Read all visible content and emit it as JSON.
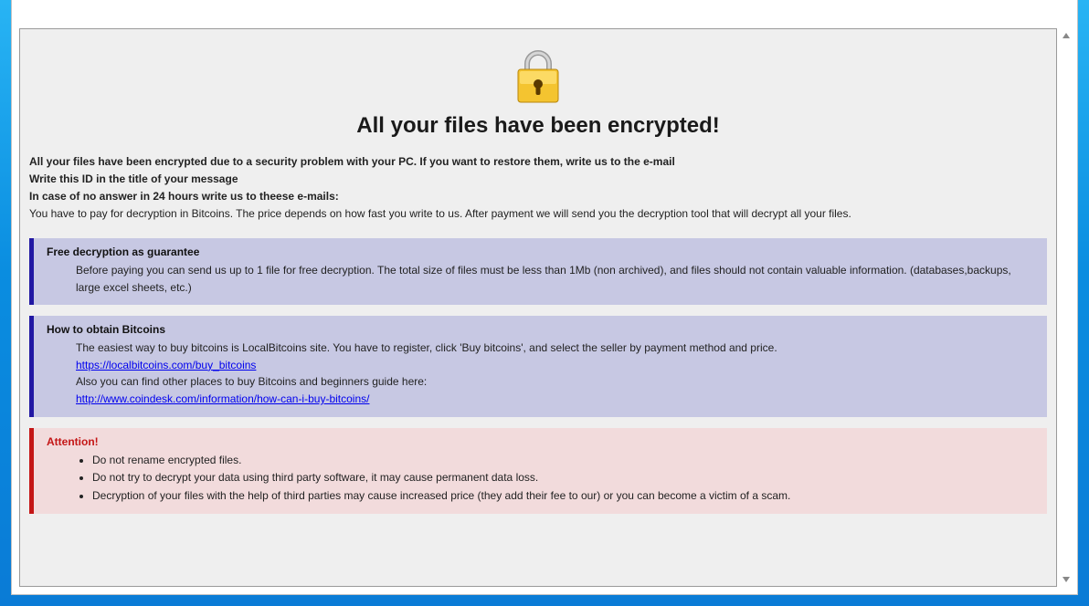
{
  "title": "All your files have been encrypted!",
  "intro": {
    "line1": "All your files have been encrypted due to a security problem with your PC. If you want to restore them, write us to the e-mail",
    "line2": "Write this ID in the title of your message",
    "line3": "In case of no answer in 24 hours write us to theese e-mails:",
    "line4": "You have to pay for decryption in Bitcoins. The price depends on how fast you write to us. After payment we will send you the decryption tool that will decrypt all your files."
  },
  "guarantee": {
    "title": "Free decryption as guarantee",
    "body": "Before paying you can send us up to 1 file for free decryption. The total size of files must be less than 1Mb (non archived), and files should not contain valuable information. (databases,backups, large excel sheets, etc.)"
  },
  "obtain": {
    "title": "How to obtain Bitcoins",
    "line1": "The easiest way to buy bitcoins is LocalBitcoins site. You have to register, click 'Buy bitcoins', and select the seller by payment method and price.",
    "link1": "https://localbitcoins.com/buy_bitcoins",
    "line2": "Also you can find other places to buy Bitcoins and beginners guide here:",
    "link2": "http://www.coindesk.com/information/how-can-i-buy-bitcoins/"
  },
  "attention": {
    "title": "Attention!",
    "items": [
      "Do not rename encrypted files.",
      "Do not try to decrypt your data using third party software, it may cause permanent data loss.",
      "Decryption of your files with the help of third parties may cause increased price (they add their fee to our) or you can become a victim of a scam."
    ]
  }
}
